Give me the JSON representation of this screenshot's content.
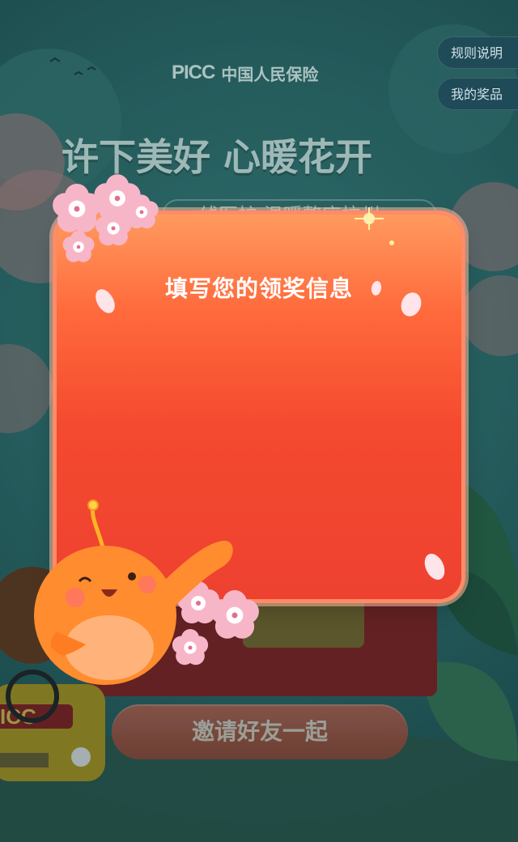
{
  "header": {
    "logo_mark": "PICC",
    "logo_text": "中国人民保险"
  },
  "banner": {
    "title": "许下美好 心暖花开",
    "subtitle": "一线医护 温暖整座杭州"
  },
  "side_menu": {
    "rules_label": "规则说明",
    "prizes_label": "我的奖品"
  },
  "modal": {
    "title": "填写您的领奖信息"
  },
  "footer": {
    "invite_label": "邀请好友一起"
  },
  "colors": {
    "modal_top": "#ff9a5e",
    "modal_bottom": "#ee4130",
    "background": "#2c6b6a",
    "mascot": "#ff8c2e"
  }
}
